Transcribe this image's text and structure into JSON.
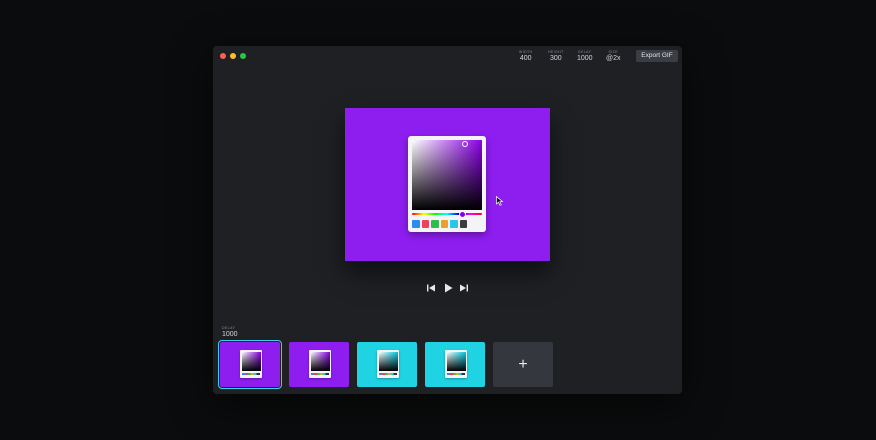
{
  "params": [
    {
      "label": "WIDTH",
      "value": "400"
    },
    {
      "label": "HEIGHT",
      "value": "300"
    },
    {
      "label": "DELAY",
      "value": "1000"
    },
    {
      "label": "SIZE",
      "value": "@2x"
    }
  ],
  "export_label": "Export GIF",
  "canvas": {
    "background": "#8e1ef0"
  },
  "picker": {
    "swatches": [
      "#2a8cf0",
      "#f04060",
      "#2ebd4a",
      "#f0a028",
      "#25c8e8",
      "#3a3c40"
    ]
  },
  "playback": {
    "prev_icon": "skip-back-icon",
    "play_icon": "play-icon",
    "next_icon": "skip-forward-icon"
  },
  "frame_delay": {
    "label": "DELAY",
    "value": "1000"
  },
  "frames": [
    {
      "background": "#8e1ef0",
      "sv_color": "#8a00e6",
      "selected": true
    },
    {
      "background": "#8e1ef0",
      "sv_color": "#8a00e6",
      "selected": false
    },
    {
      "background": "#1fd3e3",
      "sv_color": "#00c8e0",
      "selected": false
    },
    {
      "background": "#1fd3e3",
      "sv_color": "#00c8e0",
      "selected": false
    }
  ],
  "add_label": "+"
}
